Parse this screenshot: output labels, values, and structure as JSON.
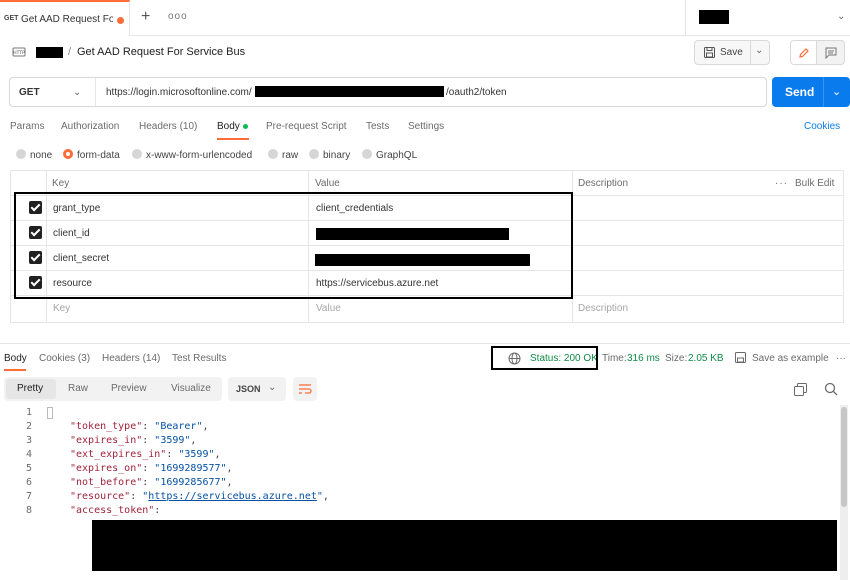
{
  "tabbar": {
    "tab": {
      "method": "GET",
      "title": "Get AAD Request For S"
    },
    "more": "ooo"
  },
  "header": {
    "title": "Get AAD Request For Service Bus",
    "save_label": "Save"
  },
  "request": {
    "method": "GET",
    "url_prefix": "https://login.microsoftonline.com/",
    "url_suffix": "/oauth2/token",
    "send_label": "Send"
  },
  "request_tabs": [
    {
      "label": "Params"
    },
    {
      "label": "Authorization"
    },
    {
      "label": "Headers (10)"
    },
    {
      "label": "Body"
    },
    {
      "label": "Pre-request Script"
    },
    {
      "label": "Tests"
    },
    {
      "label": "Settings"
    }
  ],
  "cookies_link": "Cookies",
  "body_types": [
    "none",
    "form-data",
    "x-www-form-urlencoded",
    "raw",
    "binary",
    "GraphQL"
  ],
  "params_table": {
    "headers": {
      "key": "Key",
      "value": "Value",
      "description": "Description"
    },
    "bulk_edit": "Bulk Edit",
    "rows": [
      {
        "key": "grant_type",
        "value": "client_credentials",
        "checked": true
      },
      {
        "key": "client_id",
        "value": "",
        "checked": true
      },
      {
        "key": "client_secret",
        "value": "",
        "checked": true
      },
      {
        "key": "resource",
        "value": "https://servicebus.azure.net",
        "checked": true
      }
    ],
    "placeholder": {
      "key": "Key",
      "value": "Value",
      "description": "Description"
    }
  },
  "response": {
    "tabs": [
      {
        "label": "Body"
      },
      {
        "label": "Cookies (3)"
      },
      {
        "label": "Headers (14)"
      },
      {
        "label": "Test Results"
      }
    ],
    "status": "Status: 200 OK",
    "time_label": "Time:",
    "time_value": "316 ms",
    "size_label": "Size:",
    "size_value": "2.05 KB",
    "save_example": "Save as example",
    "views": [
      "Pretty",
      "Raw",
      "Preview",
      "Visualize"
    ],
    "format": "JSON",
    "lines": [
      {
        "n": "1",
        "text": "{"
      },
      {
        "n": "2",
        "key": "\"token_type\"",
        "val": "\"Bearer\""
      },
      {
        "n": "3",
        "key": "\"expires_in\"",
        "val": "\"3599\""
      },
      {
        "n": "4",
        "key": "\"ext_expires_in\"",
        "val": "\"3599\""
      },
      {
        "n": "5",
        "key": "\"expires_on\"",
        "val": "\"1699289577\""
      },
      {
        "n": "6",
        "key": "\"not_before\"",
        "val": "\"1699285677\""
      },
      {
        "n": "7",
        "key": "\"resource\"",
        "val": "https://servicebus.azure.net"
      },
      {
        "n": "8",
        "key": "\"access_token\"",
        "val": ""
      }
    ]
  },
  "colors": {
    "accent": "#ff6c37",
    "send": "#097bed",
    "status_ok": "#0f8a45"
  }
}
